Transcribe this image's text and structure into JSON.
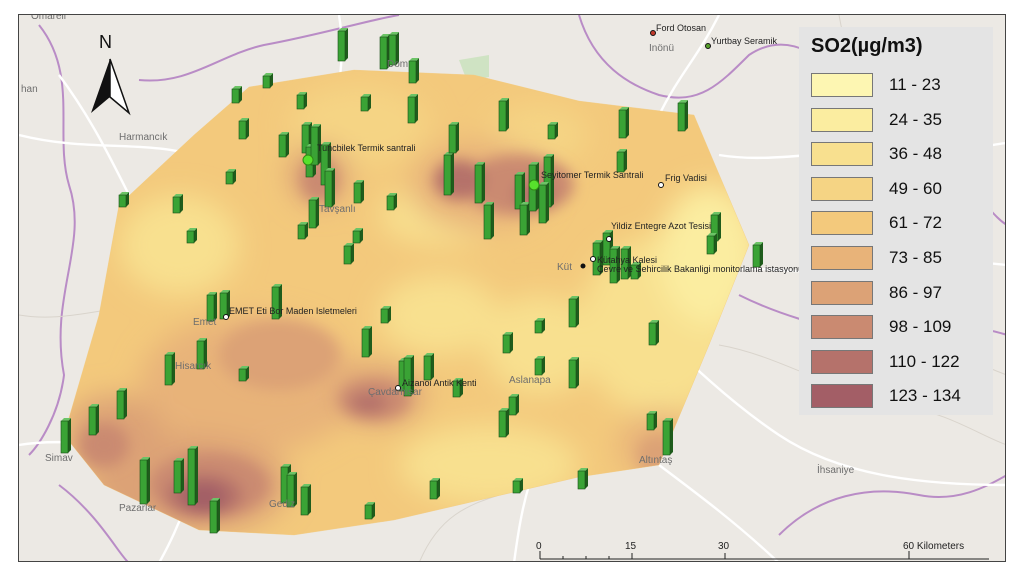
{
  "map": {
    "pollutant": "SO2",
    "colors": {
      "background": "#ece9e4",
      "bar": "#3aa335",
      "bar_side": "#1f5c1c",
      "plant_marker": "#57e12c",
      "province_border": "#b98cc6",
      "road": "#ffffff"
    }
  },
  "legend": {
    "title": "SO2(µg/m3)",
    "classes": [
      {
        "label": "11 - 23",
        "color": "#fdf6b2"
      },
      {
        "label": "24 - 35",
        "color": "#fbeda0"
      },
      {
        "label": "36 - 48",
        "color": "#f8e08f"
      },
      {
        "label": "49 - 60",
        "color": "#f5d484"
      },
      {
        "label": "61 - 72",
        "color": "#f3c97c"
      },
      {
        "label": "73 - 85",
        "color": "#e8b379"
      },
      {
        "label": "86 - 97",
        "color": "#dca276"
      },
      {
        "label": "98 - 109",
        "color": "#ca8a71"
      },
      {
        "label": "110 - 122",
        "color": "#b5726b"
      },
      {
        "label": "123 - 134",
        "color": "#a35e66"
      }
    ]
  },
  "north_arrow": {
    "label": "N"
  },
  "scale_bar": {
    "ticks": [
      "0",
      "15",
      "30",
      "60 Kilometers"
    ]
  },
  "facilities": [
    "Tuncbilek Termik santrali",
    "Seyitomer Termik Santrali",
    "Frig Vadisi",
    "Yildiz Entegre Azot Tesisi",
    "Kütahya Kalesi",
    "Çevre ve Sehircilik Bakanligi monitorlama istasyonu",
    "EMET Eti Bor Maden Isletmeleri",
    "Aizanoi Antik Kenti",
    "Ford Otosan",
    "Yurtbay Seramik"
  ],
  "basemap_towns": [
    "Omarell",
    "Dom",
    "Inönü",
    "han",
    "Harmancık",
    "Tavşanlı",
    "Küt",
    "Emet",
    "Hisarcık",
    "Çavdarhisar",
    "Aslanapa",
    "Altıntaş",
    "İhsaniye",
    "Simav",
    "Pazarlar",
    "Gediz"
  ]
}
